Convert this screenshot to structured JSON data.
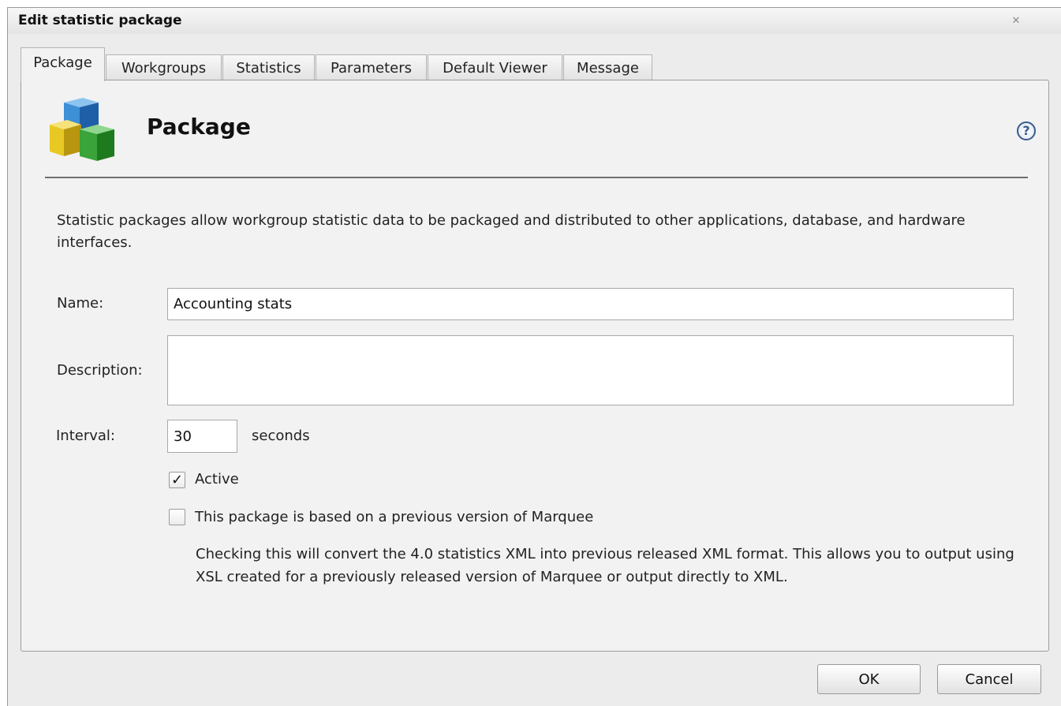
{
  "window": {
    "title": "Edit statistic package",
    "close_glyph": "✕"
  },
  "tabs": [
    {
      "label": "Package",
      "active": true
    },
    {
      "label": "Workgroups",
      "active": false
    },
    {
      "label": "Statistics",
      "active": false
    },
    {
      "label": "Parameters",
      "active": false
    },
    {
      "label": "Default Viewer",
      "active": false
    },
    {
      "label": "Message",
      "active": false
    }
  ],
  "header": {
    "title": "Package",
    "icon": "package-cubes-icon",
    "help_icon": "help-icon",
    "help_glyph": "?"
  },
  "intro": "Statistic packages allow workgroup statistic data to be packaged and distributed to other applications, database, and hardware interfaces.",
  "form": {
    "name_label": "Name:",
    "name_value": "Accounting stats",
    "description_label": "Description:",
    "description_value": "",
    "interval_label": "Interval:",
    "interval_value": "30",
    "interval_unit": "seconds",
    "active_label": "Active",
    "active_checked": true,
    "active_glyph": "✓",
    "legacy_label": "This package is based on a previous version of Marquee",
    "legacy_checked": false,
    "legacy_help": "Checking this will convert the 4.0 statistics XML into previous released XML format. This allows you to output using XSL created for a previously released version of Marquee or output directly to XML."
  },
  "buttons": {
    "ok": "OK",
    "cancel": "Cancel"
  },
  "colors": {
    "cube_blue": "#3d8fd6",
    "cube_green": "#3aa33a",
    "cube_yellow": "#e8c924"
  }
}
